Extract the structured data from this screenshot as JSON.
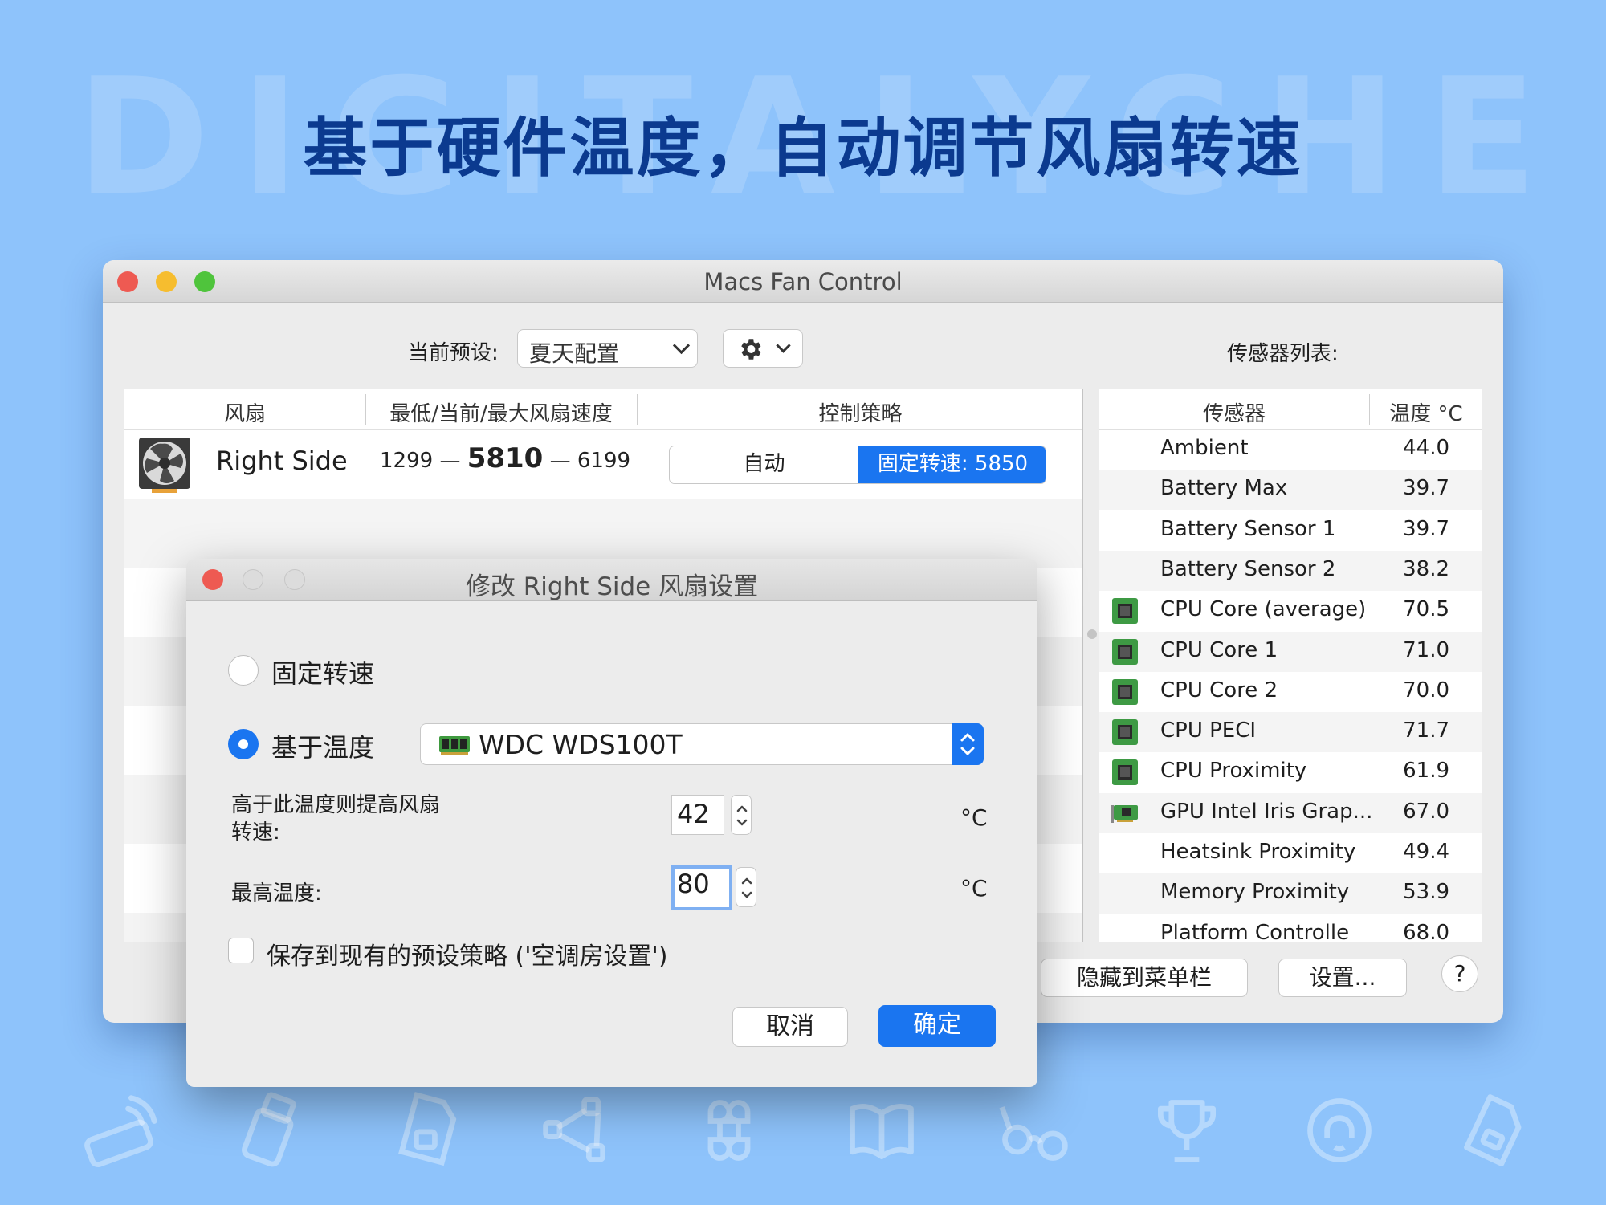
{
  "banner": {
    "watermark": "DIGITALYCHEE",
    "headline": "基于硬件温度，自动调节风扇转速"
  },
  "window": {
    "title": "Macs Fan Control",
    "preset_label": "当前预设:",
    "preset_value": "夏天配置",
    "sensor_list_label": "传感器列表:"
  },
  "fan_table": {
    "columns": [
      "风扇",
      "最低/当前/最大风扇速度",
      "控制策略"
    ],
    "row": {
      "name": "Right Side",
      "min": "1299",
      "current": "5810",
      "max": "6199",
      "dash": "—",
      "auto_label": "自动",
      "fixed_label": "固定转速: 5850"
    }
  },
  "sensor_table": {
    "columns": [
      "传感器",
      "温度 °C"
    ],
    "rows": [
      {
        "name": "Ambient",
        "value": "44.0",
        "icon": "none"
      },
      {
        "name": "Battery Max",
        "value": "39.7",
        "icon": "none"
      },
      {
        "name": "Battery Sensor 1",
        "value": "39.7",
        "icon": "none"
      },
      {
        "name": "Battery Sensor 2",
        "value": "38.2",
        "icon": "none"
      },
      {
        "name": "CPU Core (average)",
        "value": "70.5",
        "icon": "cpu-chip-icon"
      },
      {
        "name": "CPU Core 1",
        "value": "71.0",
        "icon": "cpu-chip-icon"
      },
      {
        "name": "CPU Core 2",
        "value": "70.0",
        "icon": "cpu-chip-icon"
      },
      {
        "name": "CPU PECI",
        "value": "71.7",
        "icon": "cpu-chip-icon"
      },
      {
        "name": "CPU Proximity",
        "value": "61.9",
        "icon": "cpu-chip-icon"
      },
      {
        "name": "GPU Intel Iris Grap...",
        "value": "67.0",
        "icon": "gpu-card-icon"
      },
      {
        "name": "Heatsink Proximity",
        "value": "49.4",
        "icon": "none"
      },
      {
        "name": "Memory Proximity",
        "value": "53.9",
        "icon": "none"
      },
      {
        "name": "Platform Controlle",
        "value": "68.0",
        "icon": "none"
      }
    ]
  },
  "bottom_buttons": {
    "hide": "隐藏到菜单栏",
    "settings": "设置...",
    "help": "?"
  },
  "dialog": {
    "title": "修改 Right Side 风扇设置",
    "fixed_option": "固定转速",
    "temp_option": "基于温度",
    "sensor_value": "WDC WDS100T",
    "raise_label_line1": "高于此温度则提高风扇",
    "raise_label_line2": "转速:",
    "raise_value": "42",
    "max_label": "最高温度:",
    "max_value": "80",
    "unit": "°C",
    "save_label": "保存到现有的预设策略 ('空调房设置')",
    "cancel": "取消",
    "ok": "确定"
  },
  "colors": {
    "background": "#8ec3fb",
    "headline": "#0b3a8f",
    "accent": "#1a75f0",
    "close": "#ee5a52",
    "minimize": "#f6bd2f",
    "zoom": "#4fc43c"
  }
}
